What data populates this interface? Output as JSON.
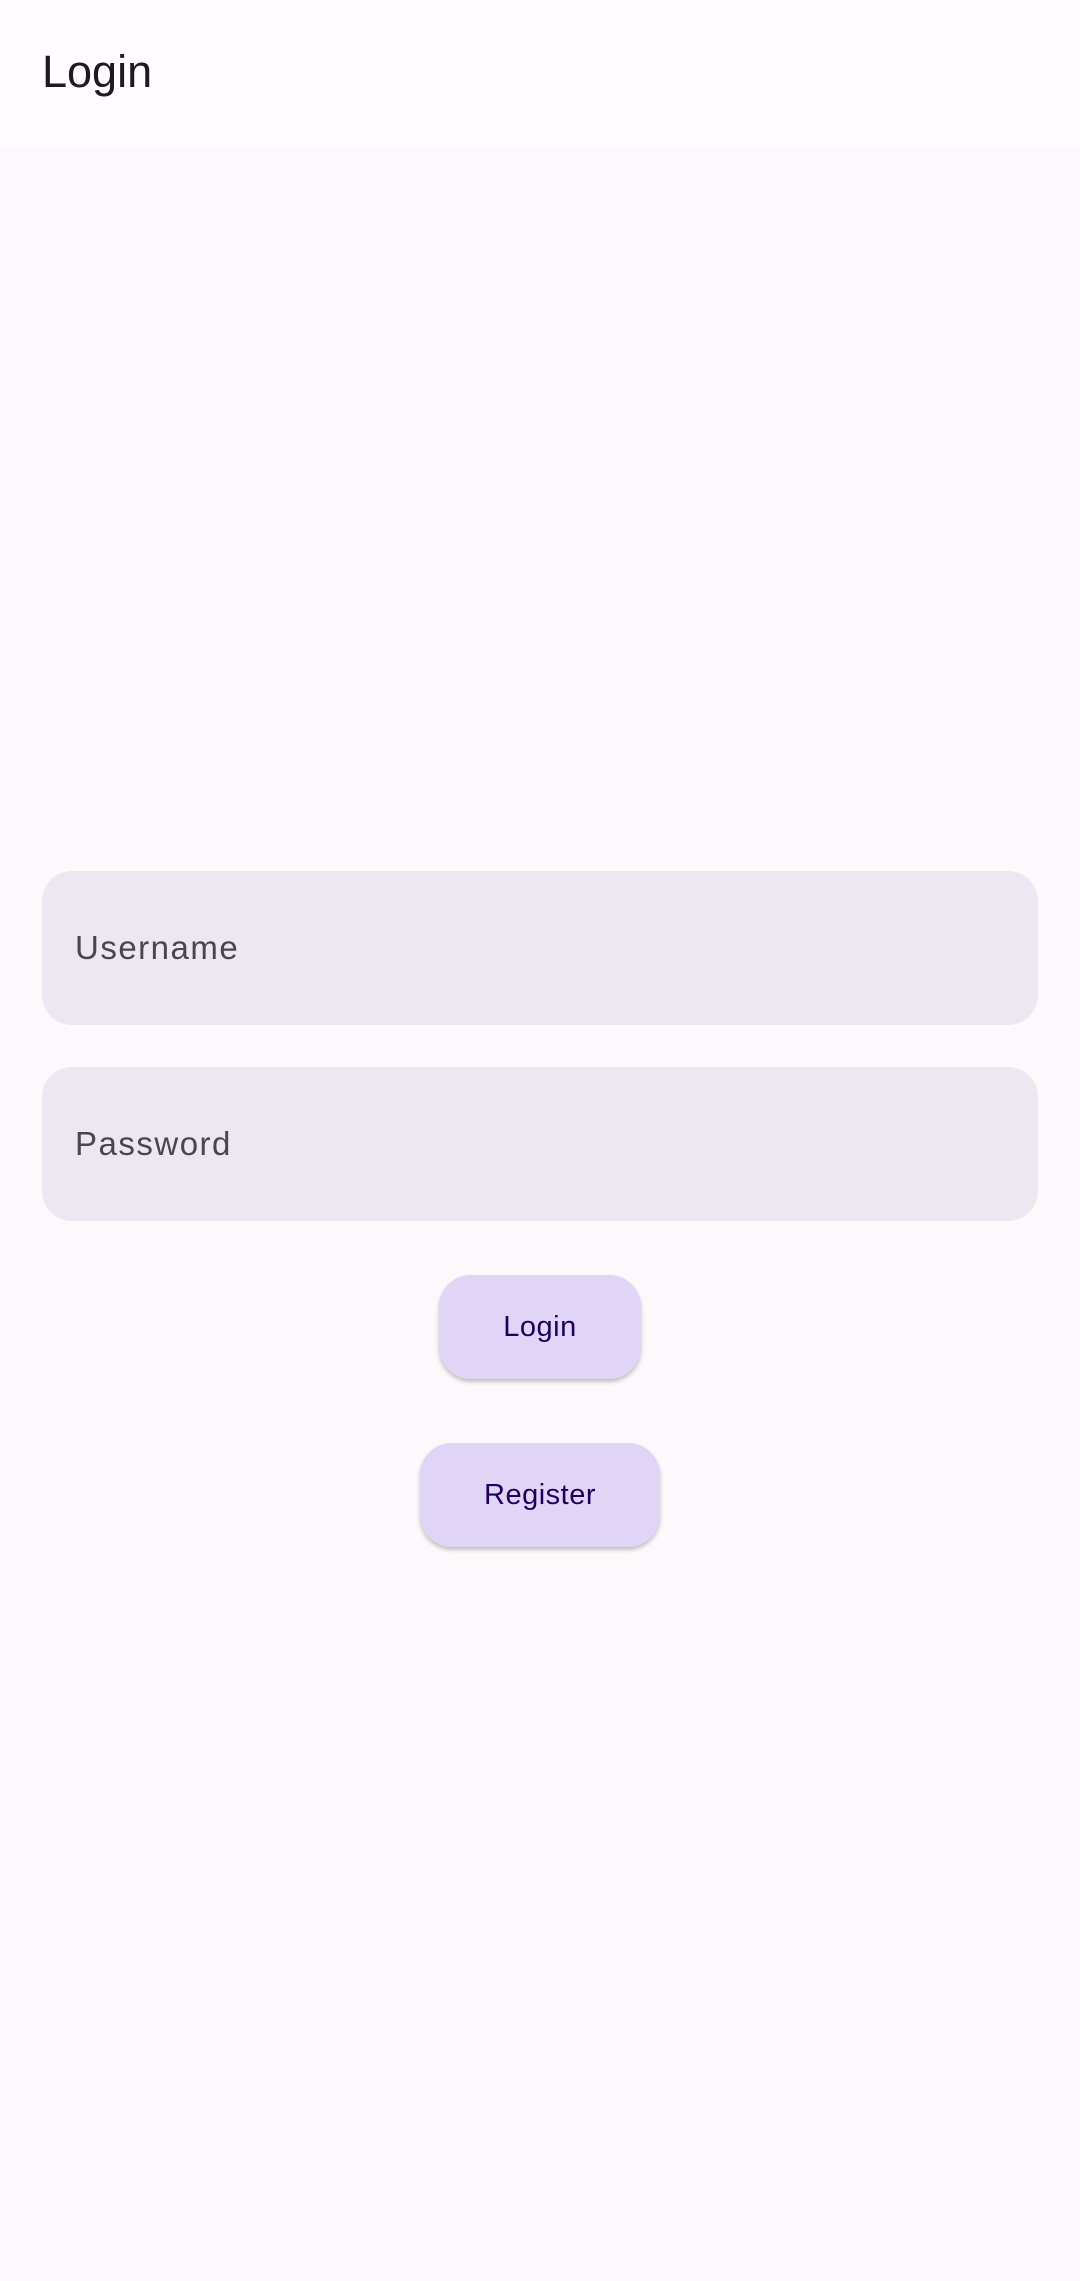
{
  "app_bar": {
    "title": "Login"
  },
  "form": {
    "username": {
      "value": "",
      "placeholder": "Username"
    },
    "password": {
      "value": "",
      "placeholder": "Password"
    },
    "login_label": "Login",
    "register_label": "Register"
  },
  "colors": {
    "background": "#fcf8fb",
    "app_bar": "#fffbfe",
    "field_fill": "#ece7f1",
    "button_fill": "#e0d4f7",
    "button_text": "#21005d"
  }
}
